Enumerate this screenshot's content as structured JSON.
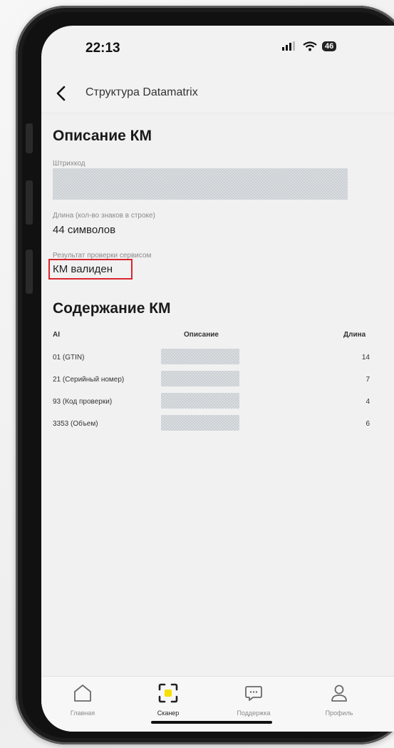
{
  "status_bar": {
    "time": "22:13",
    "battery": "46"
  },
  "header": {
    "title": "Структура Datamatrix"
  },
  "km_description": {
    "heading": "Описание КМ",
    "barcode_label": "Штрихкод",
    "length_label": "Длина (кол-во знаков в строке)",
    "length_value": "44 символов",
    "check_label": "Результат проверки сервисом",
    "check_value": "КМ валиден"
  },
  "km_content": {
    "heading": "Содержание КМ",
    "columns": {
      "ai": "AI",
      "description": "Описание",
      "length": "Длина"
    },
    "rows": [
      {
        "ai": "01 (GTIN)",
        "length": "14"
      },
      {
        "ai": "21 (Серийный номер)",
        "length": "7"
      },
      {
        "ai": "93 (Код проверки)",
        "length": "4"
      },
      {
        "ai": "3353 (Объем)",
        "length": "6"
      }
    ]
  },
  "tabbar": {
    "home": "Главная",
    "scanner": "Сканер",
    "support": "Поддержка",
    "profile": "Профиль"
  },
  "colors": {
    "accent": "#f5e000",
    "highlight_box": "#d9262c"
  }
}
